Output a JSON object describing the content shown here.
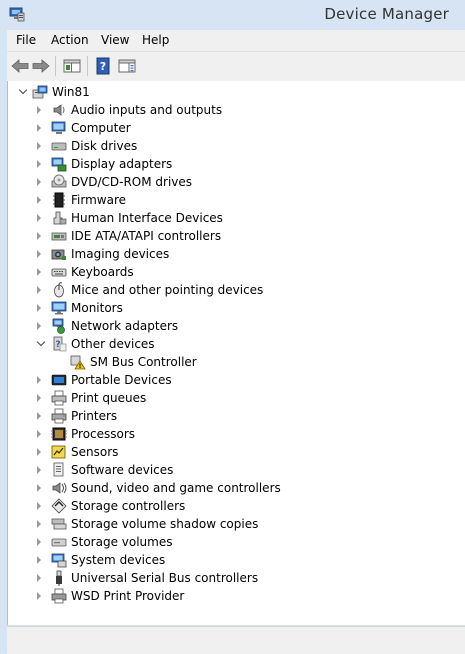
{
  "window": {
    "title": "Device Manager"
  },
  "menu": [
    "File",
    "Action",
    "View",
    "Help"
  ],
  "tree": {
    "root": "Win81",
    "categories": [
      {
        "label": "Audio inputs and outputs",
        "icon": "speaker-icon"
      },
      {
        "label": "Computer",
        "icon": "computer-icon"
      },
      {
        "label": "Disk drives",
        "icon": "disk-drive-icon"
      },
      {
        "label": "Display adapters",
        "icon": "display-adapter-icon"
      },
      {
        "label": "DVD/CD-ROM drives",
        "icon": "dvd-drive-icon"
      },
      {
        "label": "Firmware",
        "icon": "firmware-chip-icon"
      },
      {
        "label": "Human Interface Devices",
        "icon": "hid-icon"
      },
      {
        "label": "IDE ATA/ATAPI controllers",
        "icon": "ide-controller-icon"
      },
      {
        "label": "Imaging devices",
        "icon": "camera-icon"
      },
      {
        "label": "Keyboards",
        "icon": "keyboard-icon"
      },
      {
        "label": "Mice and other pointing devices",
        "icon": "mouse-icon"
      },
      {
        "label": "Monitors",
        "icon": "monitor-icon"
      },
      {
        "label": "Network adapters",
        "icon": "network-adapter-icon"
      },
      {
        "label": "Other devices",
        "icon": "unknown-device-icon",
        "expanded": true,
        "children": [
          {
            "label": "SM Bus Controller",
            "icon": "warning-device-icon"
          }
        ]
      },
      {
        "label": "Portable Devices",
        "icon": "portable-device-icon"
      },
      {
        "label": "Print queues",
        "icon": "printer-queue-icon"
      },
      {
        "label": "Printers",
        "icon": "printer-icon"
      },
      {
        "label": "Processors",
        "icon": "processor-icon"
      },
      {
        "label": "Sensors",
        "icon": "sensor-icon"
      },
      {
        "label": "Software devices",
        "icon": "software-device-icon"
      },
      {
        "label": "Sound, video and game controllers",
        "icon": "sound-icon"
      },
      {
        "label": "Storage controllers",
        "icon": "storage-controller-icon"
      },
      {
        "label": "Storage volume shadow copies",
        "icon": "shadow-copy-icon"
      },
      {
        "label": "Storage volumes",
        "icon": "storage-volume-icon"
      },
      {
        "label": "System devices",
        "icon": "system-device-icon"
      },
      {
        "label": "Universal Serial Bus controllers",
        "icon": "usb-icon"
      },
      {
        "label": "WSD Print Provider",
        "icon": "wsd-printer-icon"
      }
    ]
  },
  "colors": {
    "titlebar": "#d7e4f4",
    "chrome": "#f0f0f0",
    "tree_bg": "#ffffff",
    "icon_blue": "#1f5fb8",
    "icon_gray": "#7a7a7a",
    "warning_yellow": "#f5c400"
  }
}
